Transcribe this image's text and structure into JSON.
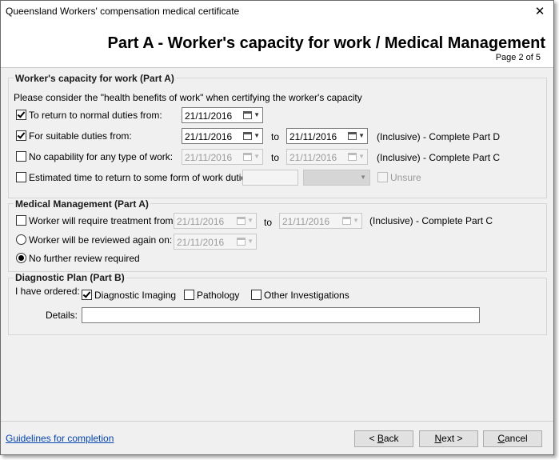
{
  "window": {
    "title": "Queensland Workers' compensation medical certificate",
    "close_glyph": "✕"
  },
  "header": {
    "title": "Part A - Worker's capacity for work / Medical Management",
    "page": "Page 2 of 5"
  },
  "capacity": {
    "legend": "Worker's capacity for work (Part A)",
    "note": "Please consider the \"health benefits of work\" when certifying the worker's capacity",
    "normal": {
      "label": "To return to normal duties from:",
      "checked": true,
      "from": "21/11/2016"
    },
    "suitable": {
      "label": "For suitable duties from:",
      "checked": true,
      "from": "21/11/2016",
      "to_label": "to",
      "to": "21/11/2016",
      "note": "(Inclusive) - Complete Part D"
    },
    "nocap": {
      "label": "No capability for any type of work:",
      "checked": false,
      "from": "21/11/2016",
      "to_label": "to",
      "to": "21/11/2016",
      "note": "(Inclusive) - Complete Part C"
    },
    "estimated": {
      "label": "Estimated time to return to some form of work duties:",
      "checked": false,
      "unsure_label": "Unsure"
    }
  },
  "medical": {
    "legend": "Medical Management (Part A)",
    "treatment": {
      "label": "Worker will require treatment from:",
      "checked": false,
      "from": "21/11/2016",
      "to_label": "to",
      "to": "21/11/2016",
      "note": "(Inclusive) - Complete Part C"
    },
    "reviewed": {
      "label": "Worker will be reviewed again on:",
      "selected": false,
      "date": "21/11/2016"
    },
    "nofurther": {
      "label": "No further review required",
      "selected": true
    }
  },
  "diagnostic": {
    "legend": "Diagnostic Plan (Part B)",
    "ordered_label": "I have ordered:",
    "imaging": {
      "label": "Diagnostic Imaging",
      "checked": true
    },
    "pathology": {
      "label": "Pathology",
      "checked": false
    },
    "other": {
      "label": "Other Investigations",
      "checked": false
    },
    "details_label": "Details:",
    "details_value": ""
  },
  "footer": {
    "guidelines_link": "Guidelines for completion",
    "back": {
      "prefix": "< ",
      "key": "B",
      "rest": "ack"
    },
    "next": {
      "key": "N",
      "rest": "ext >"
    },
    "cancel": {
      "key": "C",
      "rest": "ancel"
    }
  }
}
